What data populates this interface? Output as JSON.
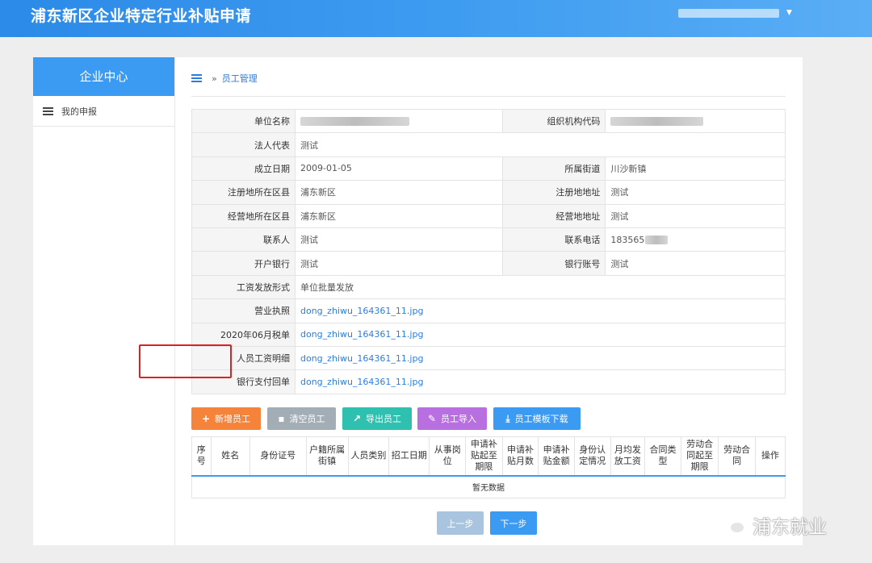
{
  "app": {
    "title": "浦东新区企业特定行业补贴申请"
  },
  "sidebar": {
    "header": "企业中心",
    "items": [
      {
        "label": "我的申报"
      }
    ]
  },
  "breadcrumb": {
    "current": "员工管理"
  },
  "info": {
    "rows": [
      {
        "label": "单位名称",
        "value": "",
        "label2": "组织机构代码",
        "value2": ""
      },
      {
        "label": "法人代表",
        "value": "测试"
      },
      {
        "label": "成立日期",
        "value": "2009-01-05",
        "label2": "所属街道",
        "value2": "川沙新镇"
      },
      {
        "label": "注册地所在区县",
        "value": "浦东新区",
        "label2": "注册地地址",
        "value2": "测试"
      },
      {
        "label": "经营地所在区县",
        "value": "浦东新区",
        "label2": "经营地地址",
        "value2": "测试"
      },
      {
        "label": "联系人",
        "value": "测试",
        "label2": "联系电话",
        "value2": "183565"
      },
      {
        "label": "开户银行",
        "value": "测试",
        "label2": "银行账号",
        "value2": "测试"
      },
      {
        "label": "工资发放形式",
        "value": "单位批量发放"
      },
      {
        "label": "营业执照",
        "value": "dong_zhiwu_164361_11.jpg"
      },
      {
        "label": "2020年06月税单",
        "value": "dong_zhiwu_164361_11.jpg"
      },
      {
        "label": "人员工资明细",
        "value": "dong_zhiwu_164361_11.jpg"
      },
      {
        "label": "银行支付回单",
        "value": "dong_zhiwu_164361_11.jpg"
      }
    ]
  },
  "actions": {
    "add": {
      "label": "新增员工",
      "icon": "+",
      "color": "#f5843a"
    },
    "clear": {
      "label": "清空员工",
      "icon": "trash",
      "color": "#a3adb6"
    },
    "export": {
      "label": "导出员工",
      "icon": "share",
      "color": "#2fc0b0"
    },
    "import": {
      "label": "员工导入",
      "icon": "edit",
      "color": "#b86fe0"
    },
    "template": {
      "label": "员工模板下载",
      "icon": "download",
      "color": "#3b9af2"
    }
  },
  "grid": {
    "columns": [
      "序号",
      "姓名",
      "身份证号",
      "户籍所属街镇",
      "人员类别",
      "招工日期",
      "从事岗位",
      "申请补贴起至期限",
      "申请补贴月数",
      "申请补贴金额",
      "身份认定情况",
      "月均发放工资",
      "合同类型",
      "劳动合同起至期限",
      "劳动合同",
      "操作"
    ],
    "empty": "暂无数据"
  },
  "pager": {
    "prev": {
      "label": "上一步",
      "color": "#a9c4de"
    },
    "next": {
      "label": "下一步",
      "color": "#3b9af2"
    }
  },
  "watermark": {
    "text": "浦东就业"
  }
}
